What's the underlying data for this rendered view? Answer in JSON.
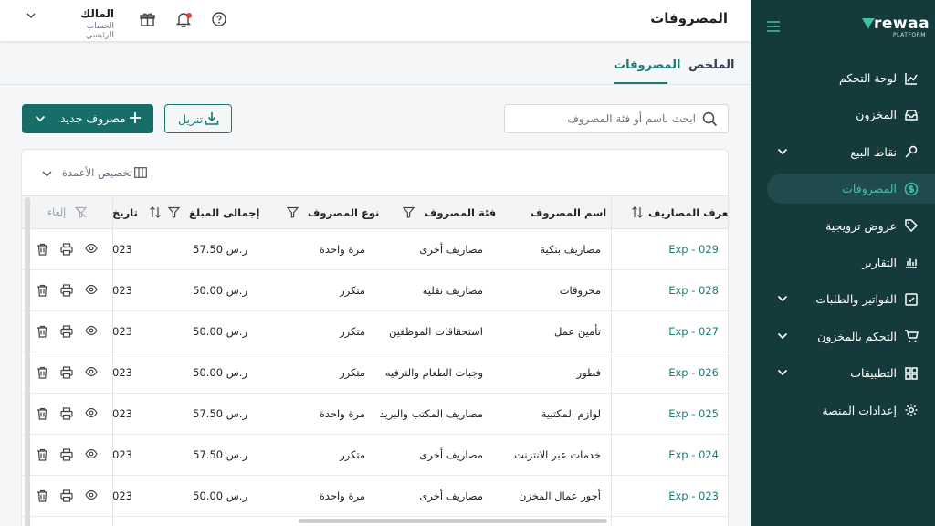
{
  "sidebar": {
    "logo_word": "rewaa",
    "logo_sub": "PLATFORM",
    "items": [
      {
        "label": "لوحة التحكم",
        "icon": "chart-line-icon",
        "chevron": false,
        "active": false
      },
      {
        "label": "المخزون",
        "icon": "inbox-icon",
        "chevron": false,
        "active": false
      },
      {
        "label": "نقاط البيع",
        "icon": "pos-tap-icon",
        "chevron": true,
        "active": false
      },
      {
        "label": "المصروفات",
        "icon": "dollar-circle-icon",
        "chevron": false,
        "active": true
      },
      {
        "label": "عروض ترويجية",
        "icon": "tag-icon",
        "chevron": false,
        "active": false
      },
      {
        "label": "التقارير",
        "icon": "bar-chart-icon",
        "chevron": false,
        "active": false
      },
      {
        "label": "الفواتير والطلبات",
        "icon": "check-square-icon",
        "chevron": true,
        "active": false
      },
      {
        "label": "التحكم بالمخزون",
        "icon": "cart-icon",
        "chevron": true,
        "active": false
      },
      {
        "label": "التطبيقات",
        "icon": "grid-icon",
        "chevron": true,
        "active": false
      },
      {
        "label": "إعدادات المنصة",
        "icon": "gear-icon",
        "chevron": false,
        "active": false
      }
    ]
  },
  "header": {
    "title": "المصروفات",
    "user_name": "المالك",
    "user_role": "الحساب الرئيسي"
  },
  "tabs": {
    "summary": "الملخص",
    "expenses": "المصروفات"
  },
  "search": {
    "placeholder": "ابحث باسم أو فئة المصروف"
  },
  "buttons": {
    "download": "تنزيل",
    "new_expense": "مصروف جديد"
  },
  "table": {
    "customize_label": "تخصيص الأعمدة",
    "headers": {
      "id": "معرف المصاريف",
      "name": "اسم المصروف",
      "category": "فئة المصروف",
      "type": "نوع المصروف",
      "total": "إجمالى المبلغ",
      "date": "تاريخ",
      "cancel": "إلغاء"
    },
    "rows": [
      {
        "id": "Exp - 029",
        "name": "مصاريف بنكية",
        "category": "مصاريف أخرى",
        "type": "مرة واحدة",
        "total": "57.50 ر.س",
        "date": "023"
      },
      {
        "id": "Exp - 028",
        "name": "محروقات",
        "category": "مصاريف نقلية",
        "type": "متكرر",
        "total": "50.00 ر.س",
        "date": "023"
      },
      {
        "id": "Exp - 027",
        "name": "تأمين عمل",
        "category": "استحقاقات الموظفين",
        "type": "متكرر",
        "total": "50.00 ر.س",
        "date": "023"
      },
      {
        "id": "Exp - 026",
        "name": "فطور",
        "category": "وجبات الطعام والترفيه",
        "type": "متكرر",
        "total": "50.00 ر.س",
        "date": "023"
      },
      {
        "id": "Exp - 025",
        "name": "لوازم المكتبية",
        "category": "مصاريف المكتب والبريد",
        "type": "مرة واحدة",
        "total": "57.50 ر.س",
        "date": "023"
      },
      {
        "id": "Exp - 024",
        "name": "خدمات عبر الانترنت",
        "category": "مصاريف أخرى",
        "type": "متكرر",
        "total": "57.50 ر.س",
        "date": "023"
      },
      {
        "id": "Exp - 023",
        "name": "أجور عمال المخزن",
        "category": "مصاريف أخرى",
        "type": "مرة واحدة",
        "total": "50.00 ر.س",
        "date": "023"
      }
    ]
  },
  "colors": {
    "sidebar_bg": "#153a3b",
    "accent": "#1b7b74",
    "active_nav_text": "#41c1a8"
  }
}
